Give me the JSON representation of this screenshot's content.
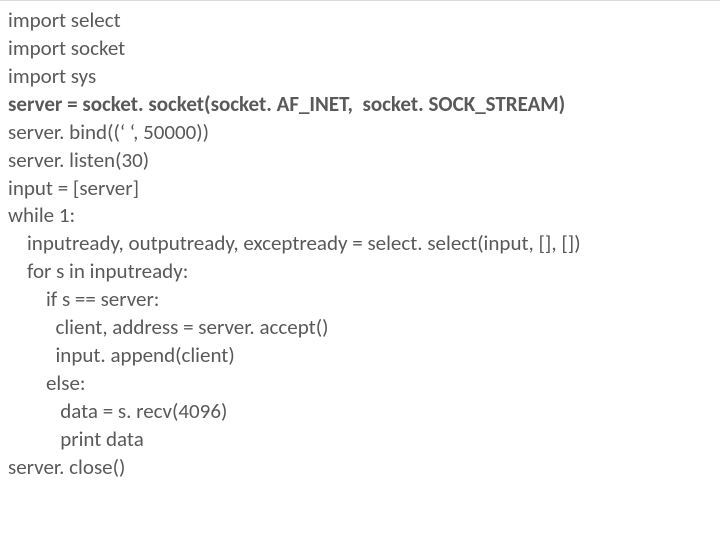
{
  "code": {
    "lines": [
      {
        "text": "import select",
        "bold": false
      },
      {
        "text": "import socket",
        "bold": false
      },
      {
        "text": "import sys",
        "bold": false
      },
      {
        "text": "server = socket. socket(socket. AF_INET,  socket. SOCK_STREAM)",
        "bold": true
      },
      {
        "text": "server. bind((‘ ‘, 50000))",
        "bold": false
      },
      {
        "text": "server. listen(30)",
        "bold": false
      },
      {
        "text": "input = [server]",
        "bold": false
      },
      {
        "text": "while 1:",
        "bold": false
      },
      {
        "text": "    inputready, outputready, exceptready = select. select(input, [], [])",
        "bold": false
      },
      {
        "text": "    for s in inputready:",
        "bold": false
      },
      {
        "text": "        if s == server:",
        "bold": false
      },
      {
        "text": "          client, address = server. accept()",
        "bold": false
      },
      {
        "text": "          input. append(client)",
        "bold": false
      },
      {
        "text": "        else:",
        "bold": false
      },
      {
        "text": "           data = s. recv(4096)",
        "bold": false
      },
      {
        "text": "           print data",
        "bold": false
      },
      {
        "text": "server. close()",
        "bold": false
      }
    ]
  }
}
